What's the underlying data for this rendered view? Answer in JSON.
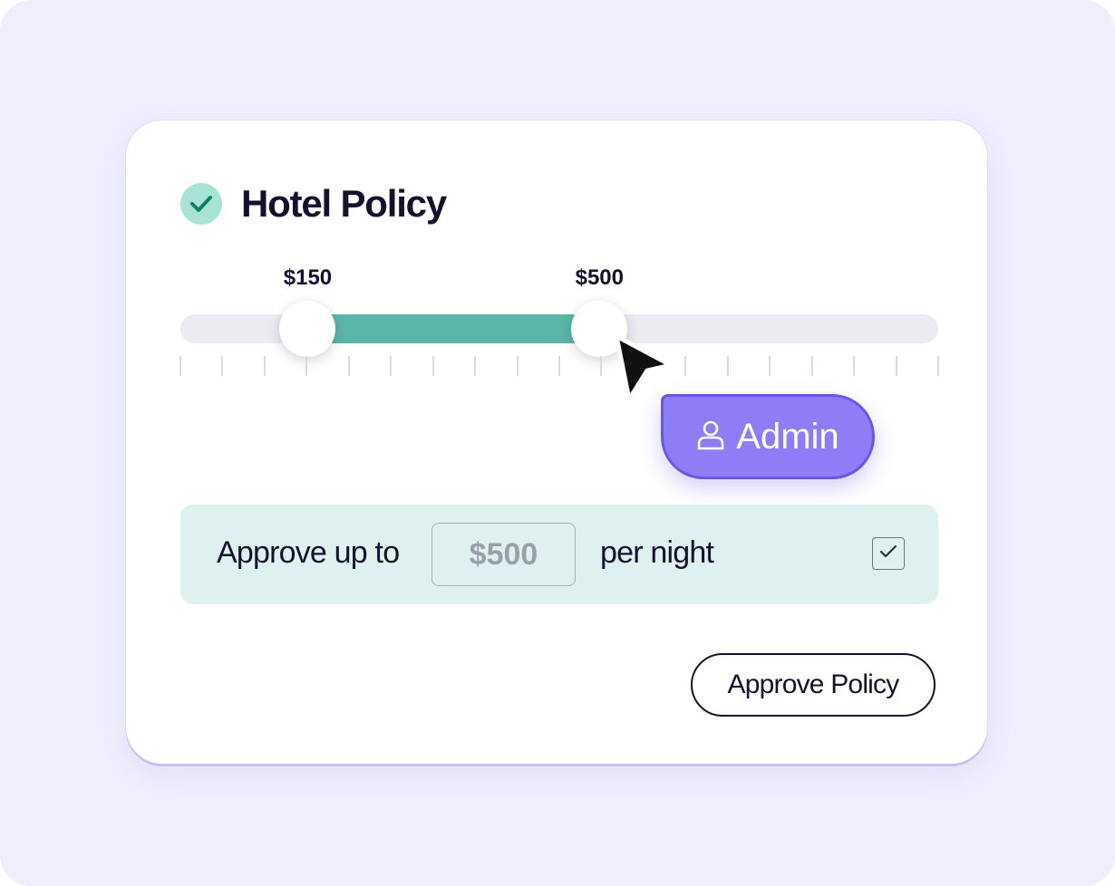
{
  "title": "Hotel Policy",
  "slider": {
    "min_label": "$150",
    "max_label": "$500",
    "min_fraction": 0.168,
    "max_fraction": 0.553,
    "tick_count": 19
  },
  "admin_badge": {
    "label": "Admin",
    "icon": "user-icon"
  },
  "approve_row": {
    "prefix": "Approve up to",
    "amount": "$500",
    "suffix": "per night",
    "checked": true
  },
  "approve_button": {
    "label": "Approve Policy"
  },
  "colors": {
    "background": "#efeefc",
    "accent_teal": "#5bb6aa",
    "badge_teal": "#a9e3d4",
    "admin_purple": "#8f7cf7",
    "row_tint": "#def1ee",
    "text_dark": "#14112e"
  }
}
